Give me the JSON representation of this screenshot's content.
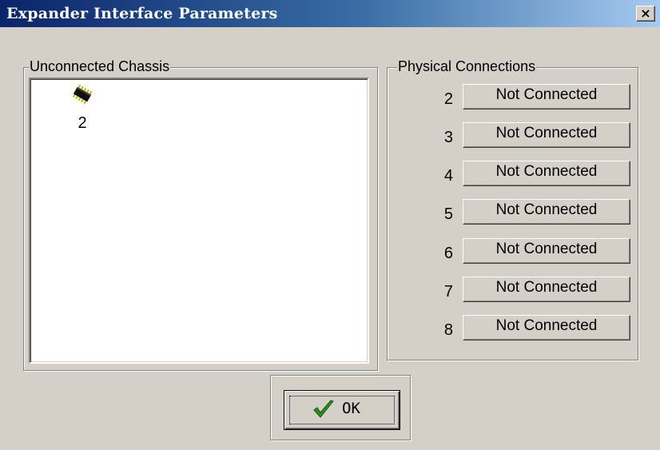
{
  "window": {
    "title": "Expander Interface Parameters",
    "close_glyph": "×"
  },
  "unconnected": {
    "caption": "Unconnected Chassis",
    "items": [
      {
        "label": "2",
        "icon": "chip-icon"
      }
    ]
  },
  "physical": {
    "caption": "Physical Connections",
    "rows": [
      {
        "number": "2",
        "button": "Not Connected"
      },
      {
        "number": "3",
        "button": "Not Connected"
      },
      {
        "number": "4",
        "button": "Not Connected"
      },
      {
        "number": "5",
        "button": "Not Connected"
      },
      {
        "number": "6",
        "button": "Not Connected"
      },
      {
        "number": "7",
        "button": "Not Connected"
      },
      {
        "number": "8",
        "button": "Not Connected"
      }
    ]
  },
  "ok": {
    "label": "OK",
    "icon": "checkmark-icon",
    "check_color": "#2e8b1e"
  },
  "colors": {
    "titlebar_start": "#0a246a",
    "titlebar_end": "#a6caf0",
    "face": "#d4d0c8"
  }
}
